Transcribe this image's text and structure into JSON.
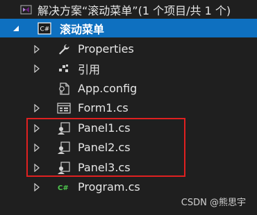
{
  "solution": {
    "label": "解决方案“滚动菜单”(1 个项目/共 1 个)"
  },
  "project": {
    "label": "滚动菜单"
  },
  "items": [
    {
      "label": "Properties",
      "icon": "wrench-icon"
    },
    {
      "label": "引用",
      "icon": "references-icon"
    },
    {
      "label": "App.config",
      "icon": "config-file-icon"
    },
    {
      "label": "Form1.cs",
      "icon": "form-icon"
    },
    {
      "label": "Panel1.cs",
      "icon": "user-control-icon"
    },
    {
      "label": "Panel2.cs",
      "icon": "user-control-icon"
    },
    {
      "label": "Panel3.cs",
      "icon": "user-control-icon"
    },
    {
      "label": "Program.cs",
      "icon": "csharp-file-icon"
    }
  ],
  "watermark": "CSDN @熊思宇",
  "colors": {
    "background": "#1f1f1f",
    "selected_row": "#0e70c0",
    "highlight_box": "#e02020",
    "text": "#e6e6e6"
  }
}
